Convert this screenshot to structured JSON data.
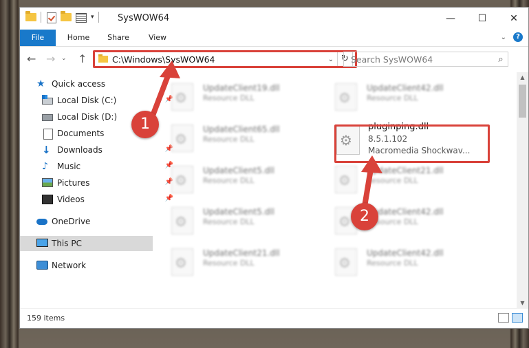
{
  "window": {
    "title": "SysWOW64",
    "minimize": "—",
    "maximize": "☐",
    "close": "✕"
  },
  "ribbon": {
    "tabs": [
      "File",
      "Home",
      "Share",
      "View"
    ]
  },
  "address": {
    "path": "C:\\Windows\\SysWOW64",
    "search_placeholder": "Search SysWOW64"
  },
  "sidebar": {
    "items": [
      {
        "label": "Quick access",
        "icon": "star-icon"
      },
      {
        "label": "Local Disk (C:)",
        "icon": "drive-c-icon"
      },
      {
        "label": "Local Disk (D:)",
        "icon": "drive-d-icon"
      },
      {
        "label": "Documents",
        "icon": "documents-icon"
      },
      {
        "label": "Downloads",
        "icon": "downloads-icon"
      },
      {
        "label": "Music",
        "icon": "music-icon"
      },
      {
        "label": "Pictures",
        "icon": "pictures-icon"
      },
      {
        "label": "Videos",
        "icon": "videos-icon"
      },
      {
        "label": "OneDrive",
        "icon": "cloud-icon"
      },
      {
        "label": "This PC",
        "icon": "computer-icon"
      },
      {
        "label": "Network",
        "icon": "network-icon"
      }
    ]
  },
  "files": {
    "left": [
      {
        "name": "UpdateClient19.dll",
        "desc": "Resource DLL"
      },
      {
        "name": "UpdateClient65.dll",
        "desc": "Resource DLL"
      },
      {
        "name": "UpdateClient5.dll",
        "desc": "Resource DLL"
      },
      {
        "name": "UpdateClient5.dll",
        "desc": "Resource DLL"
      },
      {
        "name": "UpdateClient21.dll",
        "desc": "Resource DLL"
      }
    ],
    "right_top": {
      "name": "UpdateClient42.dll",
      "desc": "Resource DLL"
    },
    "highlighted": {
      "name": "pluginping.dll",
      "version": "8.5.1.102",
      "desc": "Macromedia Shockwav..."
    },
    "right_rest": [
      {
        "name": "UpdateClient21.dll",
        "desc": "Resource DLL"
      },
      {
        "name": "UpdateClient42.dll",
        "desc": "Resource DLL"
      },
      {
        "name": "UpdateClient42.dll",
        "desc": "Resource DLL"
      }
    ]
  },
  "status": {
    "items_count": "159 items"
  },
  "annotations": {
    "step1": "1",
    "step2": "2"
  },
  "colors": {
    "accent": "#1979ca",
    "annotation": "#d9423a"
  }
}
